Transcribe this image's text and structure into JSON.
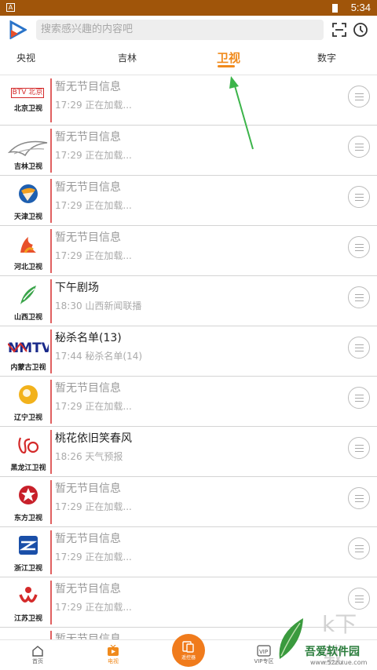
{
  "status_bar": {
    "time": "5:34",
    "app_icon": "A"
  },
  "header": {
    "search_placeholder": "搜索感兴趣的内容吧",
    "logo_icon": "play-logo-icon",
    "scan_icon": "scan-icon",
    "history_icon": "clock-icon"
  },
  "tabs": [
    {
      "label": "央视",
      "active": false
    },
    {
      "label": "吉林",
      "active": false
    },
    {
      "label": "卫视",
      "active": true
    },
    {
      "label": "数字",
      "active": false
    }
  ],
  "channels": [
    {
      "name": "北京卫视",
      "title": "暂无节目信息",
      "sub": "17:29  正在加载...",
      "empty": true
    },
    {
      "name": "吉林卫视",
      "title": "暂无节目信息",
      "sub": "17:29  正在加载...",
      "empty": true
    },
    {
      "name": "天津卫视",
      "title": "暂无节目信息",
      "sub": "17:29  正在加载...",
      "empty": true
    },
    {
      "name": "河北卫视",
      "title": "暂无节目信息",
      "sub": "17:29  正在加载...",
      "empty": true
    },
    {
      "name": "山西卫视",
      "title": "下午剧场",
      "sub": "18:30  山西新闻联播",
      "empty": false
    },
    {
      "name": "内蒙古卫视",
      "title": "秘杀名单(13)",
      "sub": "17:44  秘杀名单(14)",
      "empty": false
    },
    {
      "name": "辽宁卫视",
      "title": "暂无节目信息",
      "sub": "17:29  正在加载...",
      "empty": true
    },
    {
      "name": "黑龙江卫视",
      "title": "桃花依旧笑春风",
      "sub": "18:26  天气预报",
      "empty": false
    },
    {
      "name": "东方卫视",
      "title": "暂无节目信息",
      "sub": "17:29  正在加载...",
      "empty": true
    },
    {
      "name": "浙江卫视",
      "title": "暂无节目信息",
      "sub": "17:29  正在加载...",
      "empty": true
    },
    {
      "name": "江苏卫视",
      "title": "暂无节目信息",
      "sub": "17:29  正在加载...",
      "empty": true
    },
    {
      "name": "",
      "title": "暂无节目信息",
      "sub": "",
      "empty": true
    }
  ],
  "bottom_nav": [
    {
      "label": "首页",
      "icon": "home-icon",
      "active": false
    },
    {
      "label": "电视",
      "icon": "tv-icon",
      "active": true
    },
    {
      "label": "遥控器",
      "icon": "remote-icon",
      "active": false
    },
    {
      "label": "VIP专区",
      "icon": "vip-icon",
      "active": false
    }
  ],
  "watermark": {
    "main": "吾爱软件园",
    "url": "www.52zixue.com",
    "glyph": "k下载"
  },
  "colors": {
    "status": "#a0550a",
    "accent": "#f08a1c",
    "arrow": "#3cb44a"
  }
}
